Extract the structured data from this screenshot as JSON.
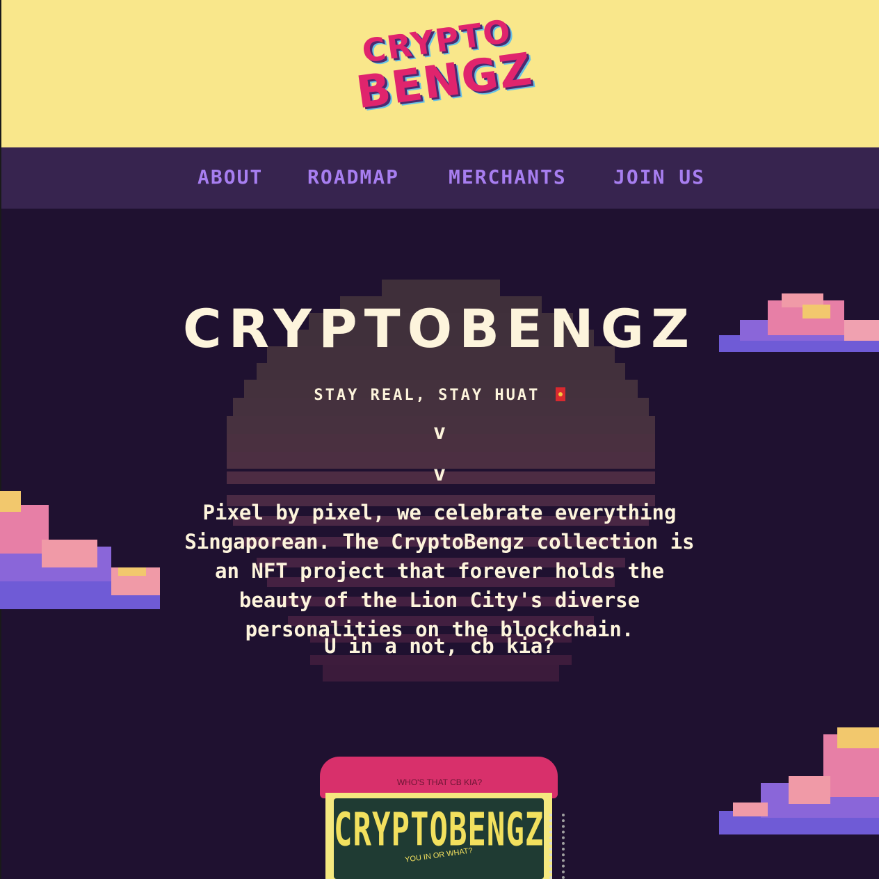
{
  "header": {
    "logo_line1": "CRYPTO",
    "logo_line2": "BENGZ"
  },
  "nav": {
    "items": [
      {
        "label": "ABOUT"
      },
      {
        "label": "ROADMAP"
      },
      {
        "label": "MERCHANTS"
      },
      {
        "label": "JOIN US"
      }
    ]
  },
  "hero": {
    "title": "CRYPTOBENGZ",
    "tagline": "STAY REAL, STAY HUAT",
    "chevron1": "v",
    "chevron2": "v",
    "body": "Pixel by pixel, we celebrate everything Singaporean. The CryptoBengz collection is an NFT project that forever holds the beauty of the Lion City's diverse personalities on the blockchain.",
    "question": "U in a not, cb kia?"
  },
  "device": {
    "top_text": "WHO'S THAT CB KIA?",
    "brand": "CRYPTOBENGZ",
    "sub_text": "YOU IN OR WHAT?"
  },
  "colors": {
    "header_bg": "#f9e78b",
    "nav_bg": "#37244f",
    "page_bg": "#1f1130",
    "nav_text": "#a77ef0",
    "logo_pink": "#e0246d",
    "text_cream": "#fdf4dc"
  }
}
